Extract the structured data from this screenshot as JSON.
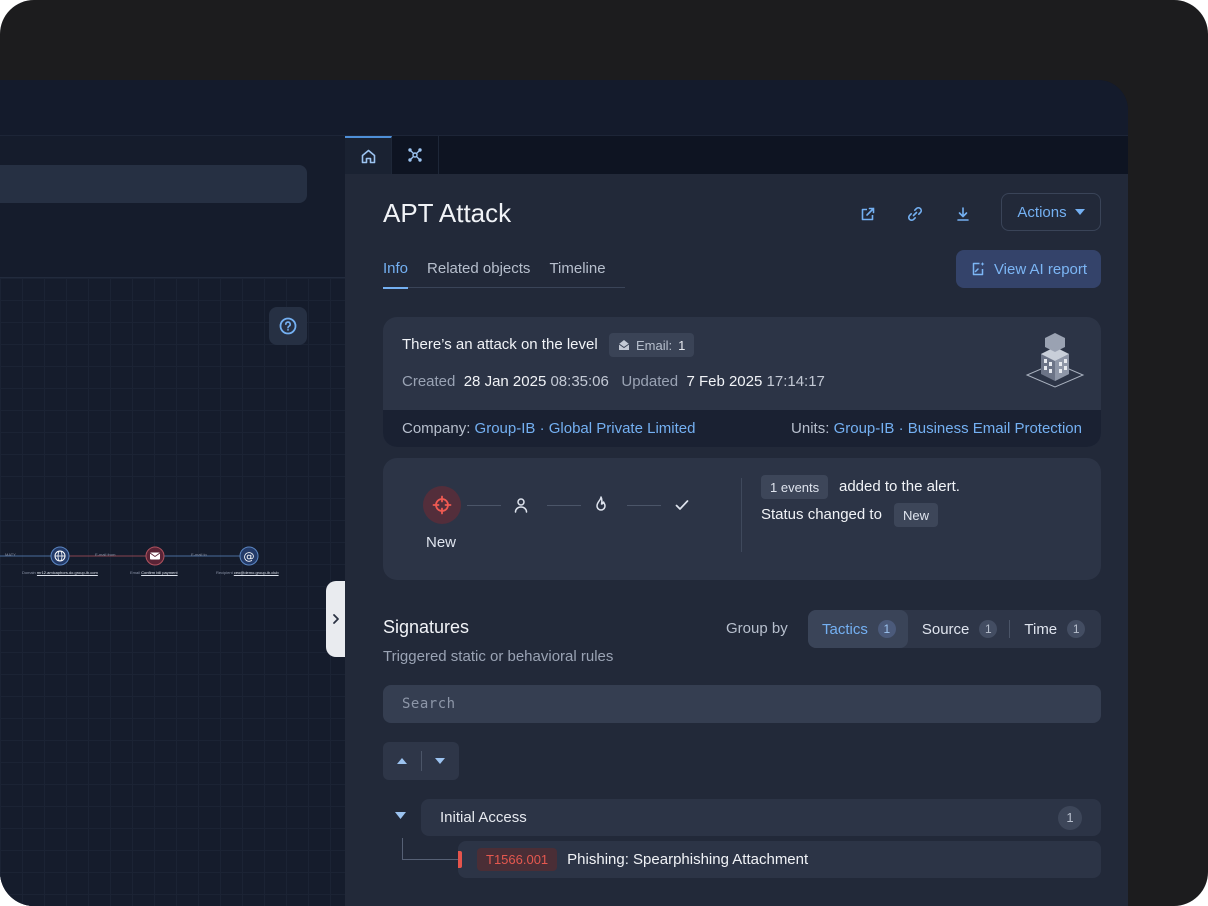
{
  "header": {
    "tabs": [
      {
        "name": "home",
        "icon": "home-icon"
      },
      {
        "name": "graph",
        "icon": "graph-nodes-icon"
      }
    ]
  },
  "graph": {
    "nodes": [
      {
        "type": "Domain",
        "value": "mr12.amicaphors.do.group-ib.com",
        "icon": "globe-icon"
      },
      {
        "type": "Email",
        "value": "Confirm bill payment",
        "icon": "envelope-icon"
      },
      {
        "type": "Recipient",
        "value": "ceo@demo.group-ib.club",
        "icon": "at-icon"
      }
    ],
    "edges": [
      "MATY",
      "E-mail from",
      "E-mail to"
    ]
  },
  "alert": {
    "title": "APT Attack",
    "actions_label": "Actions",
    "tabs": [
      "Info",
      "Related objects",
      "Timeline"
    ],
    "active_tab": "Info",
    "ai_report_label": "View AI report",
    "description": "There’s an attack on the level",
    "email_badge_label": "Email:",
    "email_badge_count": "1",
    "created_label": "Created",
    "created_date": "28 Jan 2025",
    "created_time": "08:35:06",
    "updated_label": "Updated",
    "updated_date": "7 Feb 2025",
    "updated_time": "17:14:17",
    "company_label": "Company:",
    "company_value": "Group-IB · Global Private Limited",
    "units_label": "Units:",
    "units_value": "Group-IB · Business Email Protection"
  },
  "status": {
    "current_step_label": "New",
    "steps": [
      "crosshair-icon",
      "user-icon",
      "flame-icon",
      "check-icon"
    ],
    "events_badge": "1 events",
    "events_text": "added to the alert.",
    "status_text": "Status changed to",
    "status_badge": "New"
  },
  "signatures": {
    "title": "Signatures",
    "subtitle": "Triggered static or behavioral rules",
    "group_by_label": "Group by",
    "group_options": [
      {
        "label": "Tactics",
        "count": "1",
        "active": true
      },
      {
        "label": "Source",
        "count": "1",
        "active": false
      },
      {
        "label": "Time",
        "count": "1",
        "active": false
      }
    ],
    "search_placeholder": "Search",
    "groups": [
      {
        "name": "Initial Access",
        "count": "1",
        "items": [
          {
            "code": "T1566.001",
            "name": "Phishing: Spearphishing Attachment",
            "severity_color": "#e5544c"
          }
        ]
      }
    ]
  },
  "colors": {
    "accent": "#74b0f2",
    "danger": "#e5544c",
    "panel": "#222939",
    "card": "#2c3446"
  }
}
